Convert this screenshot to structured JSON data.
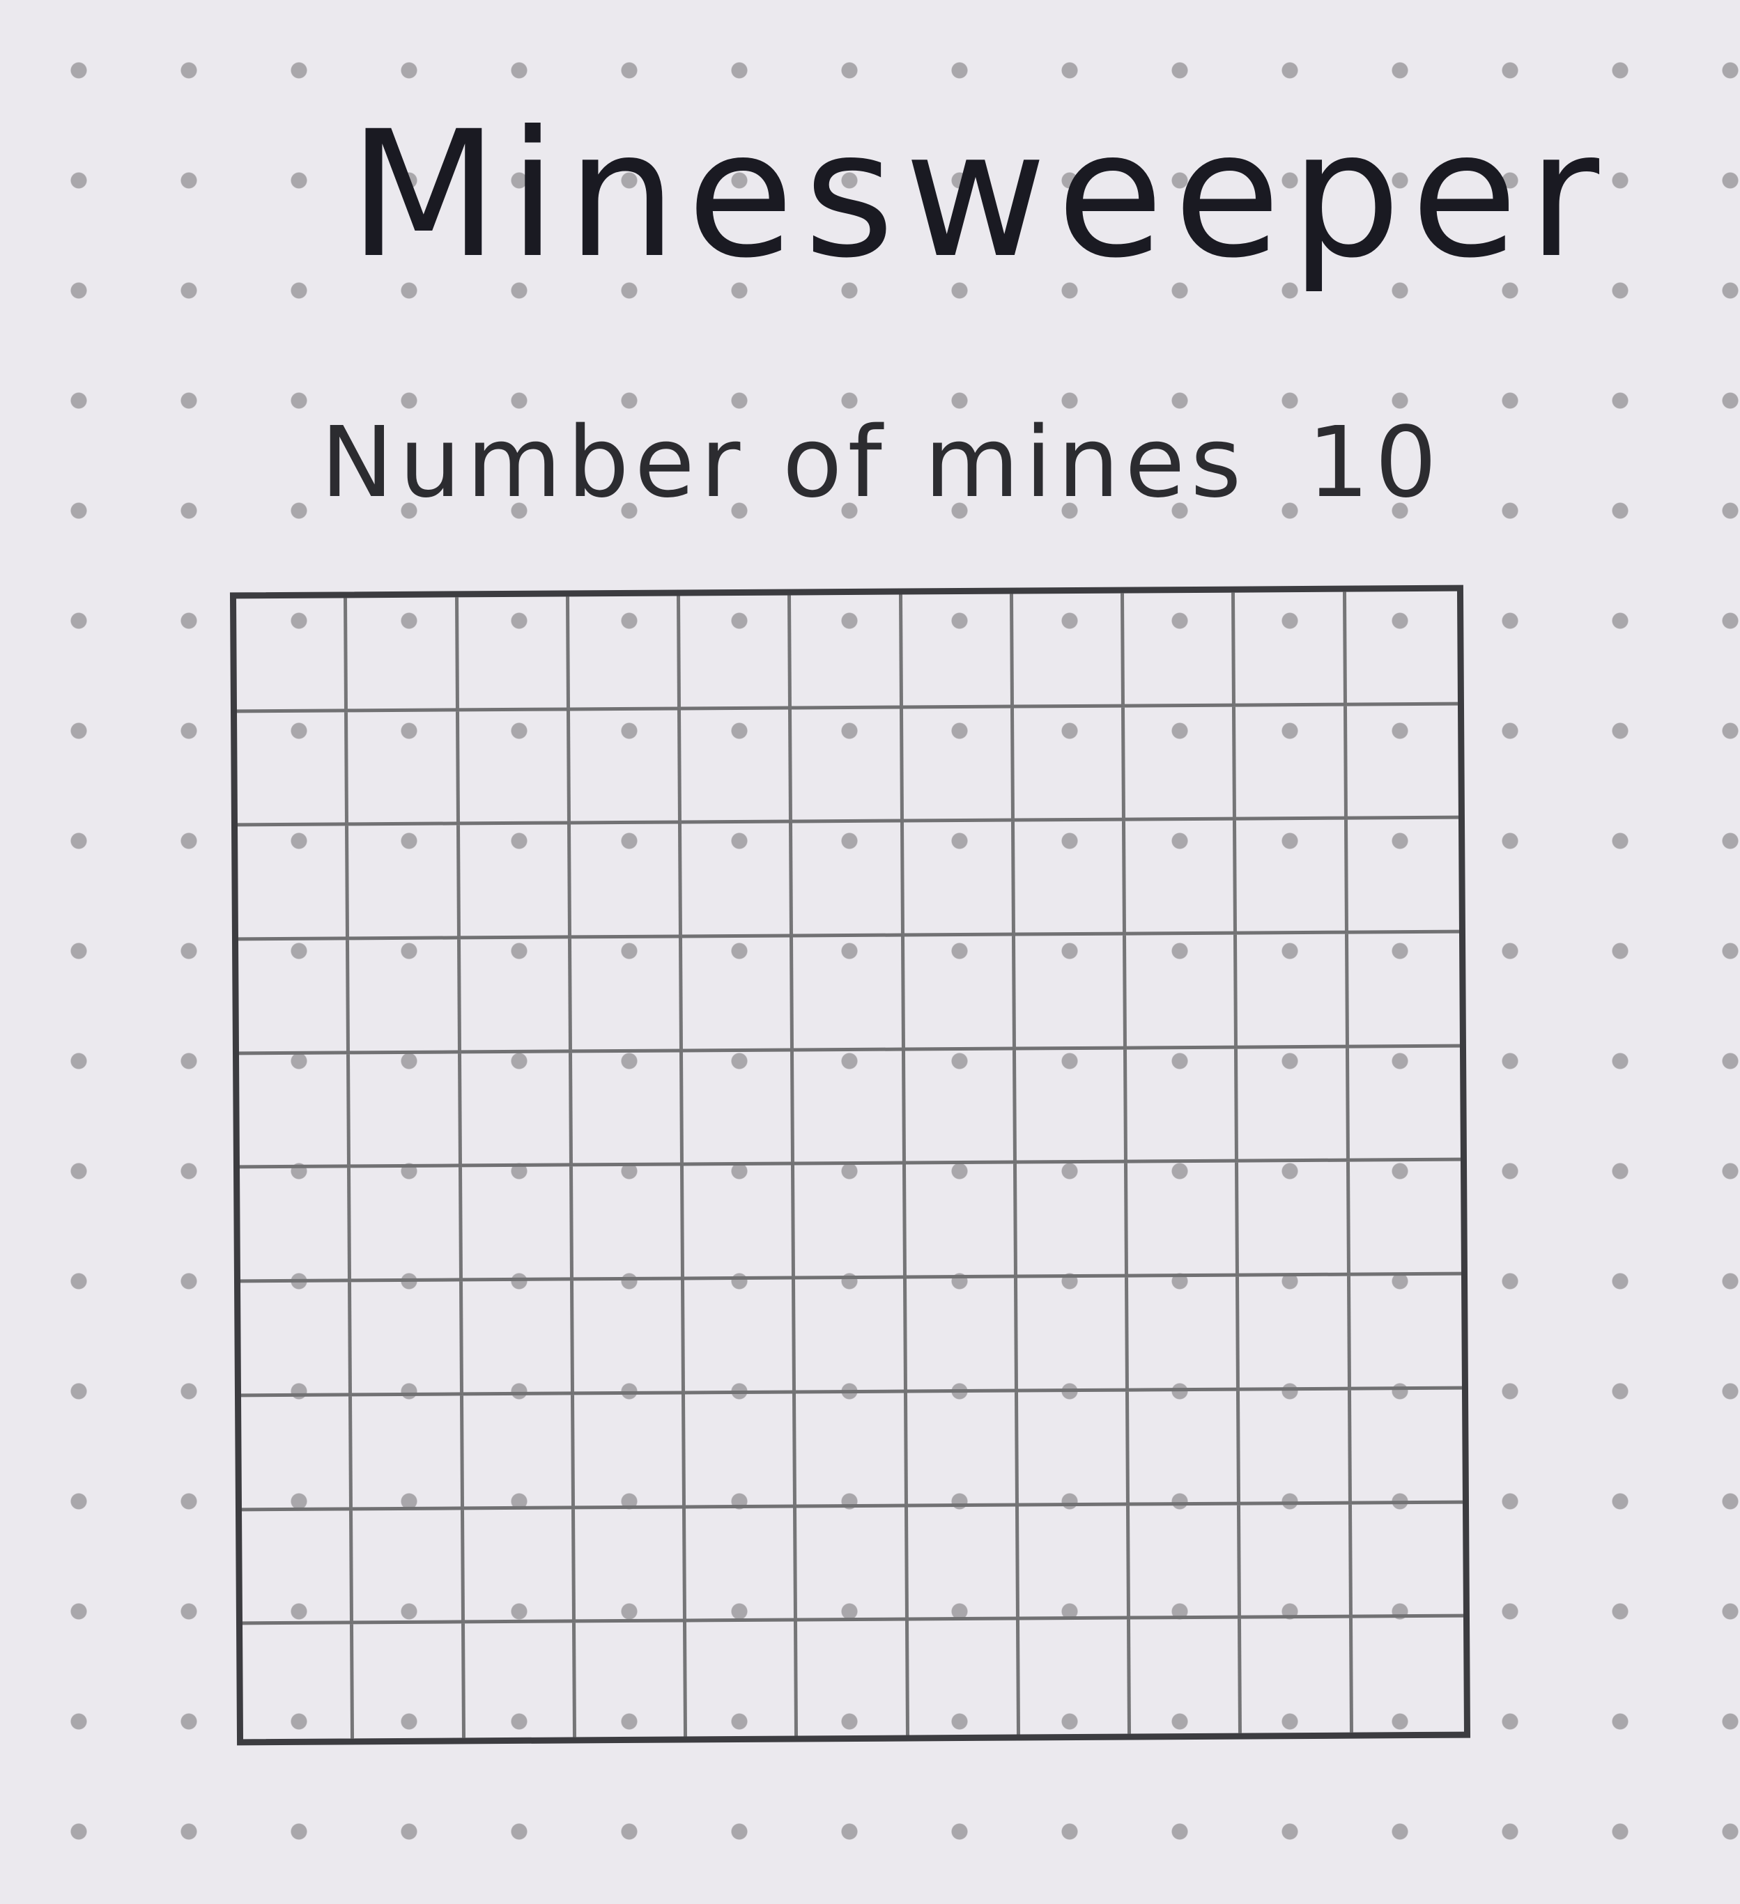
{
  "title": "Minesweeper",
  "mines": {
    "label": "Number of mines",
    "count": "10"
  },
  "board": {
    "columns": 11,
    "rows": 10
  }
}
